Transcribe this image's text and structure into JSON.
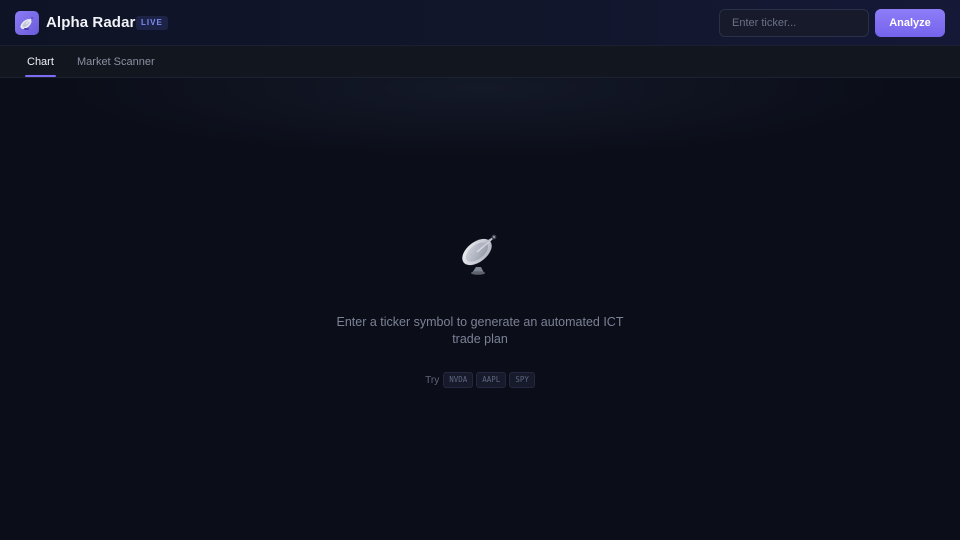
{
  "header": {
    "app_title": "Alpha Radar",
    "logo_icon": "satellite-dish-icon",
    "live_badge": "LIVE",
    "ticker_input": {
      "value": "",
      "placeholder": "Enter ticker..."
    },
    "analyze_label": "Analyze"
  },
  "tabs": [
    {
      "label": "Chart",
      "active": true
    },
    {
      "label": "Market Scanner",
      "active": false
    }
  ],
  "empty_state": {
    "icon": "satellite-dish-icon",
    "message": "Enter a ticker symbol to generate an automated ICT trade plan",
    "try_label": "Try",
    "suggestions": [
      "NVDA",
      "AAPL",
      "SPY"
    ]
  },
  "colors": {
    "accent": "#7b6cf2",
    "background": "#0b0e19",
    "live_badge_text": "#7d8cf0"
  }
}
